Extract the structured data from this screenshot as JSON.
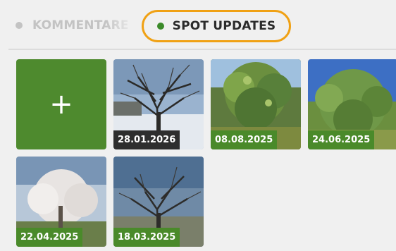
{
  "tabs": {
    "comments_label": "KOMMENTARE",
    "spot_updates_label": "SPOT UPDATES"
  },
  "add_button": {
    "label": "+"
  },
  "photos": [
    {
      "date": "28.01.2026",
      "scene": "winter",
      "label_color": "#2e2e2e"
    },
    {
      "date": "08.08.2025",
      "scene": "summer",
      "label_color": "#4a8a2a"
    },
    {
      "date": "24.06.2025",
      "scene": "summer-sky",
      "label_color": "#4a8a2a"
    },
    {
      "date": "22.04.2025",
      "scene": "blossom",
      "label_color": "#4a8a2a"
    },
    {
      "date": "18.03.2025",
      "scene": "bare",
      "label_color": "#4a8a2a"
    }
  ],
  "colors": {
    "accent": "#f0a114",
    "green": "#4e8a2e",
    "dot_active": "#3b8a2a"
  }
}
